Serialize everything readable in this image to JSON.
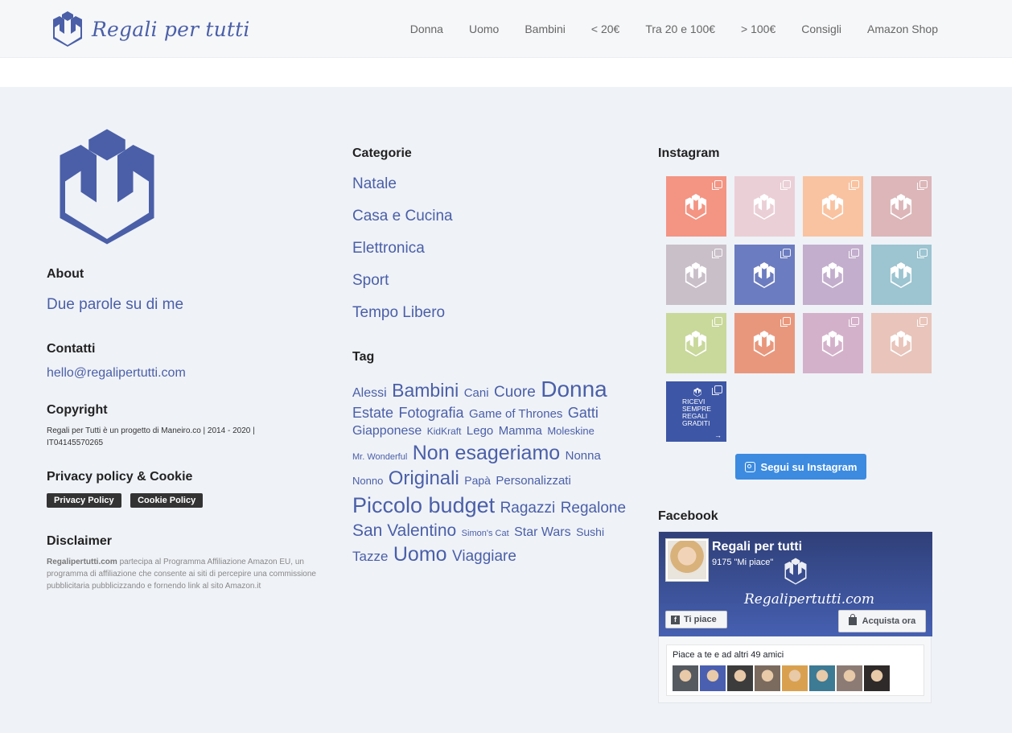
{
  "brand": {
    "name": "Regali per tutti",
    "color": "#4a5fa8"
  },
  "nav": [
    "Donna",
    "Uomo",
    "Bambini",
    "< 20€",
    "Tra 20 e 100€",
    "> 100€",
    "Consigli",
    "Amazon Shop"
  ],
  "about": {
    "heading": "About",
    "link": "Due parole su di me"
  },
  "contacts": {
    "heading": "Contatti",
    "email": "hello@regalipertutti.com"
  },
  "copyright": {
    "heading": "Copyright",
    "text": "Regali per Tutti è un progetto di Maneiro.co | 2014 - 2020 | IT04145570265"
  },
  "privacy": {
    "heading": "Privacy policy & Cookie",
    "privacy_label": "Privacy Policy",
    "cookie_label": "Cookie Policy"
  },
  "disclaimer": {
    "heading": "Disclaimer",
    "brand": "Regalipertutti.com",
    "text": " partecipa al Programma Affiliazione Amazon EU, un programma di affiliazione che consente ai siti di percepire una commissione pubblicitaria pubblicizzando e fornendo link al sito Amazon.it"
  },
  "categories": {
    "heading": "Categorie",
    "items": [
      "Natale",
      "Casa e Cucina",
      "Elettronica",
      "Sport",
      "Tempo Libero"
    ]
  },
  "tags": {
    "heading": "Tag",
    "items": [
      {
        "label": "Alessi",
        "size": 16
      },
      {
        "label": "Bambini",
        "size": 23
      },
      {
        "label": "Cani",
        "size": 15
      },
      {
        "label": "Cuore",
        "size": 19
      },
      {
        "label": "Donna",
        "size": 28
      },
      {
        "label": "Estate",
        "size": 18
      },
      {
        "label": "Fotografia",
        "size": 18
      },
      {
        "label": "Game of Thrones",
        "size": 15
      },
      {
        "label": "Gatti",
        "size": 18
      },
      {
        "label": "Giapponese",
        "size": 16
      },
      {
        "label": "KidKraft",
        "size": 12
      },
      {
        "label": "Lego",
        "size": 15
      },
      {
        "label": "Mamma",
        "size": 15
      },
      {
        "label": "Moleskine",
        "size": 13
      },
      {
        "label": "Mr. Wonderful",
        "size": 11
      },
      {
        "label": "Non esageriamo",
        "size": 25
      },
      {
        "label": "Nonna",
        "size": 15
      },
      {
        "label": "Nonno",
        "size": 13
      },
      {
        "label": "Originali",
        "size": 24
      },
      {
        "label": "Papà",
        "size": 14
      },
      {
        "label": "Personalizzati",
        "size": 15
      },
      {
        "label": "Piccolo budget",
        "size": 27
      },
      {
        "label": "Ragazzi",
        "size": 19
      },
      {
        "label": "Regalone",
        "size": 19
      },
      {
        "label": "San Valentino",
        "size": 21
      },
      {
        "label": "Simon's Cat",
        "size": 11
      },
      {
        "label": "Star Wars",
        "size": 16
      },
      {
        "label": "Sushi",
        "size": 14
      },
      {
        "label": "Tazze",
        "size": 17
      },
      {
        "label": "Uomo",
        "size": 25
      },
      {
        "label": "Viaggiare",
        "size": 19
      }
    ]
  },
  "instagram": {
    "heading": "Instagram",
    "tiles": [
      "#f49483",
      "#ebcfd6",
      "#f9c3a1",
      "#dcb6b8",
      "#c9bfc8",
      "#6c7cc0",
      "#c3aecd",
      "#9cc4d1",
      "#c9d89b",
      "#e9977c",
      "#d4b1ca",
      "#e8c4ba"
    ],
    "promo": {
      "color": "#3d56a6",
      "text": "RICEVI SEMPRE REGALI GRADITI",
      "arrow": "→"
    },
    "follow_label": "Segui su Instagram"
  },
  "facebook": {
    "heading": "Facebook",
    "page_title": "Regali per tutti",
    "likes": "9175 \"Mi piace\"",
    "script": "Regalipertutti.com",
    "like_label": "Ti piace",
    "shop_label": "Acquista ora",
    "friends_text": "Piace a te e ad altri 49 amici",
    "faces": [
      "#555a60",
      "#4a5fb0",
      "#3c3c3c",
      "#7b6b5e",
      "#d9a14f",
      "#3d7a94",
      "#8c7b75",
      "#2f2a2a"
    ]
  }
}
